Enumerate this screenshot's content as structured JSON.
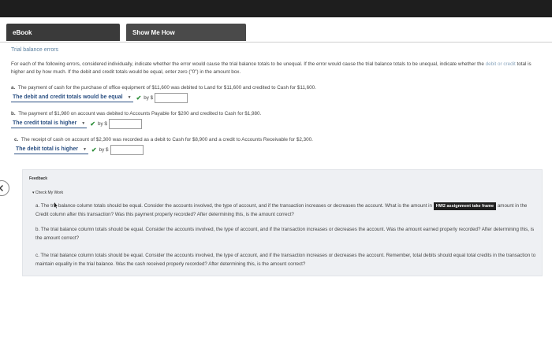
{
  "tabs": {
    "ebook": "eBook",
    "show_me_how": "Show Me How"
  },
  "title": "Trial balance errors",
  "instructions": {
    "part1": "For each of the following errors, considered individually, indicate whether the error would cause the trial balance totals to be unequal. If the error would cause the trial balance totals to be unequal, indicate whether the ",
    "link": "debit or credit",
    "part2": " total is higher and by how much. If the debit and credit totals would be equal, enter zero (\"0\") in the amount box."
  },
  "questions": [
    {
      "label": "a.",
      "text": "The payment of cash for the purchase of office equipment of $11,600 was debited to Land for $11,600 and credited to Cash for $11,600.",
      "selected": "The debit and credit totals would be equal",
      "by": "by $",
      "value": ""
    },
    {
      "label": "b.",
      "text": "The payment of $1,980 on account was debited to Accounts Payable for $200 and credited to Cash for $1,980.",
      "selected": "The credit total is higher",
      "by": "by $",
      "value": ""
    },
    {
      "label": "c.",
      "text": "The receipt of cash on account of $2,300 was recorded as a debit to Cash for $8,900 and a credit to Accounts Receivable for $2,300.",
      "selected": "The debit total is higher",
      "by": "by $",
      "value": ""
    }
  ],
  "feedback": {
    "heading": "Feedback",
    "check_my_work": "▾ Check My Work",
    "a_part1": "a. The tri",
    "a_part2": " balance column totals should be equal. Consider the accounts involved, the type of account, and if the transaction increases or decreases the account. What is the amount in",
    "tooltip": "HW2 assignment take frame",
    "a_part3": "amount in the Credit column after this transaction? Was this payment properly recorded? After determining this, is the amount correct?",
    "b": "b. The trial balance column totals should be equal. Consider the accounts involved, the type of account, and if the transaction increases or decreases the account. Was the amount earned properly recorded? After determining this, is the amount correct?",
    "c": "c. The trial balance column totals should be equal. Consider the accounts involved, the type of account, and if the transaction increases or decreases the account. Remember, total debits should equal total credits in the transaction to maintain equality in the trial balance. Was the cash received properly recorded? After determining this, is the amount correct?"
  },
  "colors": {
    "select_text": "#2a4f82",
    "check": "#2f8f3a",
    "feedback_bg": "#eef0f3"
  }
}
